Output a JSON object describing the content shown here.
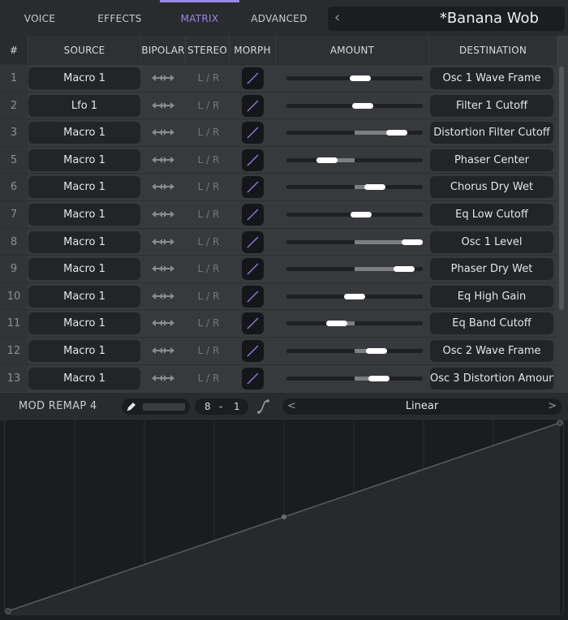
{
  "tabs": [
    {
      "label": "VOICE",
      "active": false
    },
    {
      "label": "EFFECTS",
      "active": false
    },
    {
      "label": "MATRIX",
      "active": true
    },
    {
      "label": "ADVANCED",
      "active": false
    }
  ],
  "preset": {
    "prev_icon": "chevron-left-icon",
    "name": "*Banana Wob"
  },
  "matrix": {
    "headers": {
      "num": "#",
      "source": "SOURCE",
      "bipolar": "BIPOLAR",
      "stereo": "STEREO",
      "morph": "MORPH",
      "amount": "AMOUNT",
      "destination": "DESTINATION"
    },
    "rows": [
      {
        "num": "1",
        "source": "Macro 1",
        "stereo": "L / R",
        "amount": 0.08,
        "destination": "Osc 1 Wave Frame"
      },
      {
        "num": "2",
        "source": "Lfo 1",
        "stereo": "L / R",
        "amount": 0.12,
        "destination": "Filter 1 Cutoff"
      },
      {
        "num": "3",
        "source": "Macro 1",
        "stereo": "L / R",
        "amount": 0.62,
        "destination": "Distortion Filter Cutoff"
      },
      {
        "num": "5",
        "source": "Macro 1",
        "stereo": "L / R",
        "amount": -0.4,
        "destination": "Phaser Center"
      },
      {
        "num": "6",
        "source": "Macro 1",
        "stereo": "L / R",
        "amount": 0.3,
        "destination": "Chorus Dry Wet"
      },
      {
        "num": "7",
        "source": "Macro 1",
        "stereo": "L / R",
        "amount": 0.1,
        "destination": "Eq Low Cutoff"
      },
      {
        "num": "8",
        "source": "Macro 1",
        "stereo": "L / R",
        "amount": 1.0,
        "destination": "Osc 1 Level"
      },
      {
        "num": "9",
        "source": "Macro 1",
        "stereo": "L / R",
        "amount": 0.73,
        "destination": "Phaser Dry Wet"
      },
      {
        "num": "10",
        "source": "Macro 1",
        "stereo": "L / R",
        "amount": 0.0,
        "destination": "Eq High Gain"
      },
      {
        "num": "11",
        "source": "Macro 1",
        "stereo": "L / R",
        "amount": -0.26,
        "destination": "Eq Band Cutoff"
      },
      {
        "num": "12",
        "source": "Macro 1",
        "stereo": "L / R",
        "amount": 0.32,
        "destination": "Osc 2 Wave Frame"
      },
      {
        "num": "13",
        "source": "Macro 1",
        "stereo": "L / R",
        "amount": 0.36,
        "destination": "Osc 3 Distortion Amount"
      }
    ]
  },
  "remap": {
    "title": "MOD REMAP 4",
    "grid_x": "8",
    "grid_sep": "-",
    "grid_y": "1",
    "shape_prev": "<",
    "shape": "Linear",
    "shape_next": ">",
    "curve_points": [
      [
        0,
        0
      ],
      [
        0.5,
        0.5
      ],
      [
        1,
        1
      ]
    ],
    "grid_divisions": 8
  },
  "colors": {
    "accent": "#9b86e8",
    "background": "#1c1d20",
    "panel": "#3a3b3e"
  }
}
